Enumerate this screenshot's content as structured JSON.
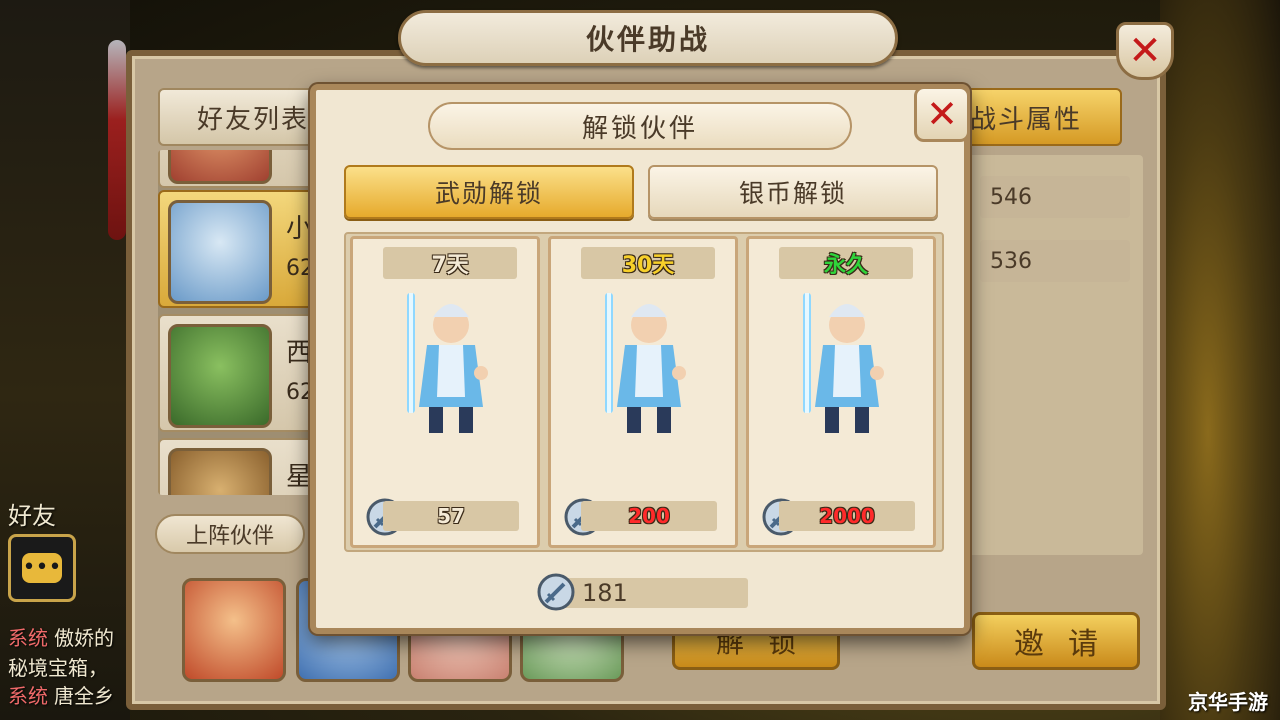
{
  "outer": {
    "title": "伙伴助战",
    "tabs": {
      "friends": "好友列表",
      "stats": "战斗属性"
    },
    "stats": [
      "546",
      "536"
    ],
    "friends": [
      {
        "name": "小",
        "value": "62"
      },
      {
        "name": "西",
        "value": "62"
      },
      {
        "name": "星",
        "value": ""
      }
    ],
    "lineup_label": "上阵伙伴",
    "unlock_button": "解锁",
    "invite_button": "邀请",
    "side_label": "好友",
    "chat": [
      {
        "tag": "系统",
        "text": "傲娇的"
      },
      {
        "tag": "",
        "text": "秘境宝箱，"
      },
      {
        "tag": "系统",
        "text": "唐全乡"
      }
    ]
  },
  "modal": {
    "title": "解锁伙伴",
    "tabs": {
      "active": "武勋解锁",
      "inactive": "银币解锁"
    },
    "options": [
      {
        "duration": "7天",
        "duration_color": "#f4ead6",
        "price": "57",
        "price_color": "#f4ead6"
      },
      {
        "duration": "30天",
        "duration_color": "#f7d02a",
        "price": "200",
        "price_color": "#ff2a2a"
      },
      {
        "duration": "永久",
        "duration_color": "#2fd43a",
        "price": "2000",
        "price_color": "#ff2a2a"
      }
    ],
    "balance": "181"
  },
  "icons": {
    "close": "close-x-icon",
    "currency": "sword-medal-icon",
    "chat": "chat-bubble-icon"
  },
  "watermark": "京华手游"
}
